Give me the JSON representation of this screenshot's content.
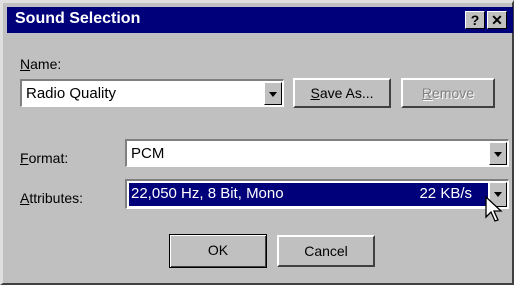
{
  "window": {
    "title": "Sound Selection",
    "help_label": "?",
    "close_label": "✕"
  },
  "name": {
    "label_u": "N",
    "label_rest": "ame:",
    "value": "Radio Quality",
    "save_u": "S",
    "save_rest": "ave As...",
    "remove_u": "R",
    "remove_rest": "emove"
  },
  "format": {
    "label_u": "F",
    "label_rest": "ormat:",
    "value": "PCM"
  },
  "attributes": {
    "label_u": "A",
    "label_rest": "ttributes:",
    "value": "22,050 Hz, 8 Bit, Mono",
    "size": "22 KB/s"
  },
  "buttons": {
    "ok": "OK",
    "cancel": "Cancel"
  },
  "colors": {
    "title_bg": "#00007b",
    "selection_bg": "#00007b",
    "face": "#c0c0c0"
  }
}
